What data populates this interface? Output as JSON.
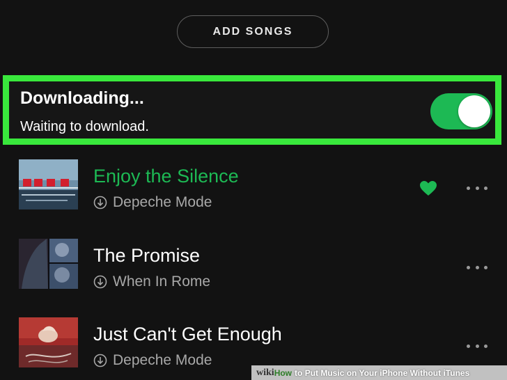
{
  "header": {
    "add_songs_label": "ADD SONGS"
  },
  "download": {
    "title": "Downloading...",
    "status": "Waiting to download.",
    "toggle_on": true,
    "accent_color": "#1db954",
    "highlight_color": "#39e83c"
  },
  "tracks": [
    {
      "title": "Enjoy the Silence",
      "artist": "Depeche Mode",
      "playing": true,
      "liked": true,
      "downloaded_icon": "download-circle-icon"
    },
    {
      "title": "The Promise",
      "artist": "When In Rome",
      "playing": false,
      "liked": false,
      "downloaded_icon": "download-circle-icon"
    },
    {
      "title": "Just Can't Get Enough",
      "artist": "Depeche Mode",
      "playing": false,
      "liked": false,
      "downloaded_icon": "download-circle-icon"
    }
  ],
  "watermark": {
    "wiki": "wiki",
    "how": "How",
    "rest": "to Put Music on Your iPhone Without iTunes"
  }
}
